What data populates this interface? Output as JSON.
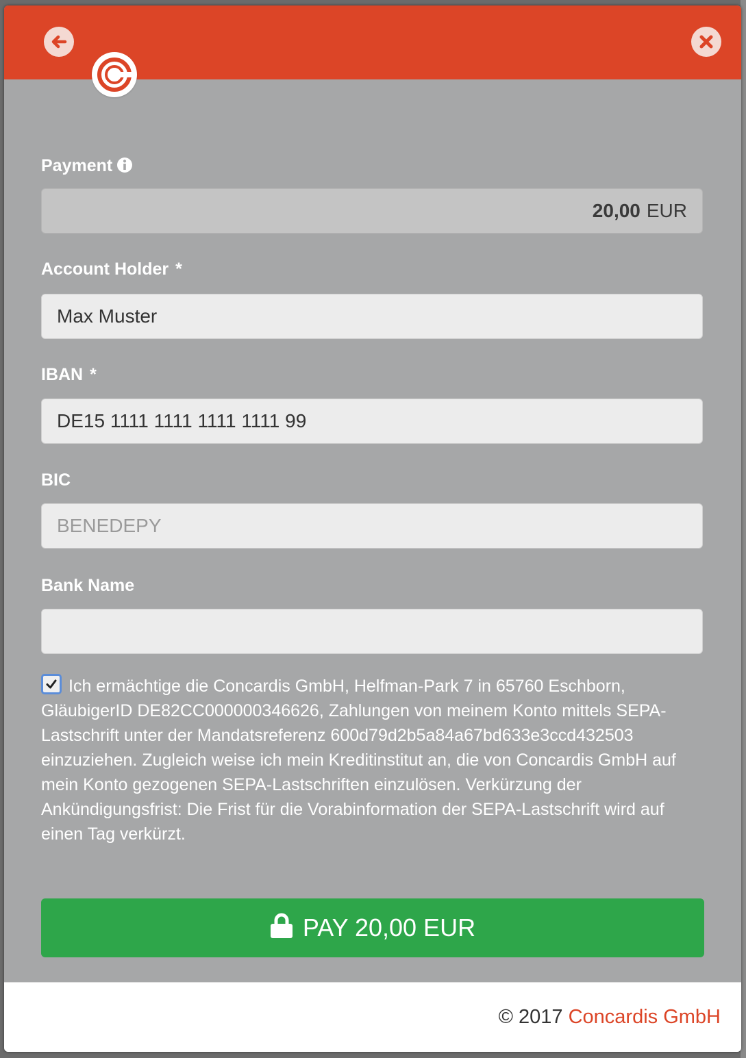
{
  "header": {
    "back_icon": "arrow-left-icon",
    "close_icon": "close-icon",
    "logo_icon": "concardis-logo",
    "brand_color": "#dc4527"
  },
  "payment": {
    "label": "Payment",
    "info_icon": "info-icon",
    "amount": "20,00",
    "currency": "EUR"
  },
  "account_holder": {
    "label": "Account Holder",
    "required_mark": "*",
    "value": "Max Muster"
  },
  "iban": {
    "label": "IBAN",
    "required_mark": "*",
    "value": "DE15 1111 1111 1111 1111 99"
  },
  "bic": {
    "label": "BIC",
    "placeholder": "BENEDEPY"
  },
  "bank_name": {
    "label": "Bank Name",
    "value": ""
  },
  "mandate": {
    "checked": true,
    "text": "Ich ermächtige die Concardis GmbH, Helfman-Park 7 in 65760 Eschborn, GläubigerID DE82CC000000346626, Zahlungen von meinem Konto mittels SEPA-Lastschrift unter der Mandatsreferenz 600d79d2b5a84a67bd633e3ccd432503 einzuziehen. Zugleich weise ich mein Kreditinstitut an, die von Concardis GmbH auf mein Konto gezogenen SEPA-Lastschriften einzulösen. Verkürzung der Ankündigungsfrist: Die Frist für die Vorabinformation der SEPA-Lastschrift wird auf einen Tag verkürzt."
  },
  "pay_button": {
    "label": "PAY 20,00 EUR",
    "icon": "lock-icon",
    "color": "#2ea64a"
  },
  "footer": {
    "copyright": "© 2017",
    "company": "Concardis GmbH"
  }
}
